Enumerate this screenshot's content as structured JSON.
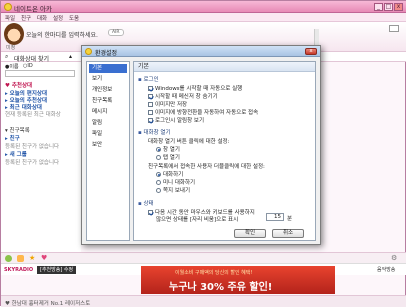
{
  "app": {
    "title": "네이트온 아카",
    "min_label": "_",
    "max_label": "□",
    "close_label": "x"
  },
  "menu": [
    "파일",
    "친구",
    "대화",
    "설정",
    "도움"
  ],
  "profile": {
    "status_message": "오늘의 한마디를 입력하세요.",
    "status_badge": "AIR",
    "avatar_label": "미정"
  },
  "sidebar": {
    "tab_title": "대화상대 찾기",
    "search_placeholder": "검색",
    "filter_labels": [
      "●이름",
      "○ID"
    ],
    "lines": [
      {
        "text": "♥ 추천상대",
        "style": "red"
      },
      {
        "text": "▸ 오늘의 편지상대",
        "style": "blue"
      },
      {
        "text": "▸ 오늘의 추천상대",
        "style": "blue"
      },
      {
        "text": "▸ 최근 대화상대",
        "style": "blue"
      },
      {
        "text": "   현재 등록된 최근 대화상",
        "style": "gray"
      },
      {
        "text": "▾ 친구목록",
        "style": "normal"
      },
      {
        "text": "  ▸ 친구",
        "style": "blue"
      },
      {
        "text": "     등록된 친구가 없습니다",
        "style": "gray"
      },
      {
        "text": "  ▸ 새 그룹",
        "style": "blue"
      },
      {
        "text": "     등록된 친구가 없습니다",
        "style": "gray"
      }
    ]
  },
  "radio": {
    "logo": "SKYRADIO",
    "channel": "[추천방송] 수정",
    "right_button": "음악방송"
  },
  "ad": {
    "line1": "이월소비 구매액의 당신의 할인 혜택!",
    "line2": "누구나 30% 주유 할인!"
  },
  "footer": {
    "text": "♥ 한남대 흉터제거 No.1 레이저스토"
  },
  "dialog": {
    "title": "환경설정",
    "close_label": "x",
    "nav": [
      "기본",
      "보기",
      "개인정보",
      "친구목록",
      "메시지",
      "알림",
      "파일",
      "보안"
    ],
    "selected_nav": "기본",
    "panel_header": "기본",
    "sections": {
      "login": {
        "title": "로그인",
        "options": [
          {
            "label": "Windows를 시작할 때 자동으로 실행",
            "checked": true
          },
          {
            "label": "시작할 때 메신저 창 숨기기",
            "checked": true
          },
          {
            "label": "이미지만 저장",
            "checked": false
          },
          {
            "label": "이미지에 방향전환을 자동하여 자동으로 접속",
            "checked": false
          },
          {
            "label": "로그인시 알림창 보기",
            "checked": true
          }
        ]
      },
      "chat": {
        "title": "대화창 열기",
        "q1": "대화창 열기 버튼 클릭에 대한 설정:",
        "q1_options": [
          {
            "label": "창 열기",
            "checked": true
          },
          {
            "label": "탭 열기",
            "checked": false
          }
        ],
        "q2": "친구목록에서 접속한 사용자 더블클릭에 대한 설정:",
        "q2_options": [
          {
            "label": "대화하기",
            "checked": true
          },
          {
            "label": "미니 대화하기",
            "checked": false
          },
          {
            "label": "쪽지 보내기",
            "checked": false
          }
        ]
      },
      "status": {
        "title": "상태",
        "option_line1": "다음 시간 동안 마우스와 키보드를 사용하지",
        "option_line2": "않으면 상태를 [자리 비움]으로 표시",
        "checked": true,
        "minutes": "15",
        "unit": "분"
      }
    },
    "ok_label": "확인",
    "cancel_label": "취소"
  }
}
